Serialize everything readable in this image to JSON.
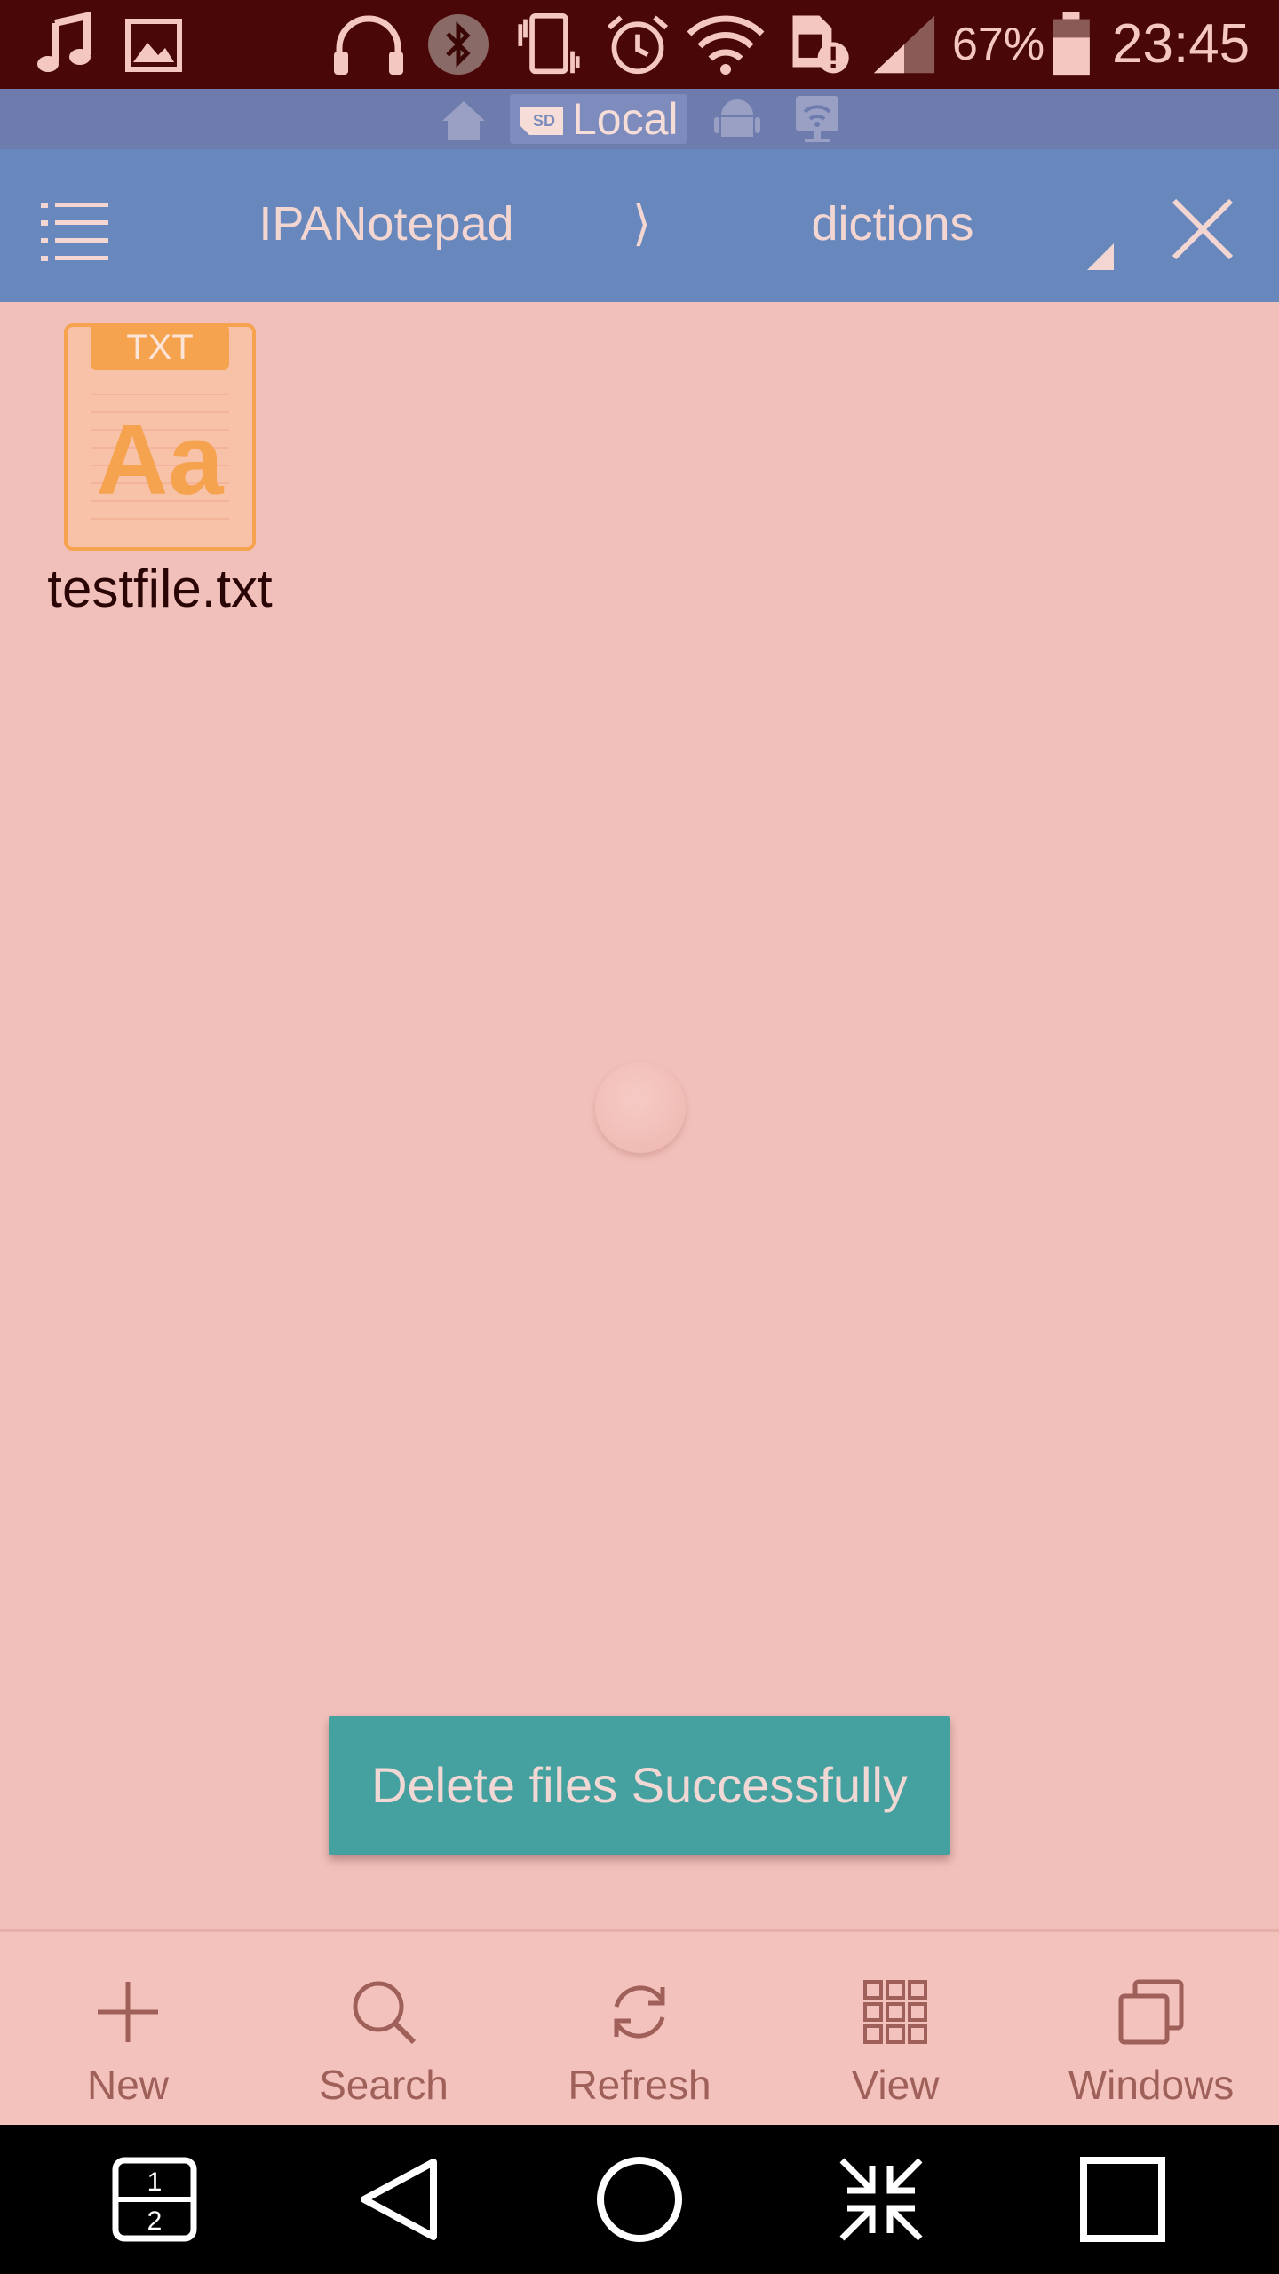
{
  "status_bar": {
    "icons": [
      "music-note-icon",
      "image-icon",
      "headphones-icon",
      "bluetooth-icon",
      "vibrate-icon",
      "alarm-icon",
      "wifi-icon",
      "sim-alert-icon",
      "cell-signal-icon",
      "battery-icon"
    ],
    "battery_percent": "67%",
    "time": "23:45"
  },
  "location_bar": {
    "items": [
      "home-icon",
      "sd-card-icon",
      "android-icon",
      "remote-wifi-icon"
    ],
    "active_label": "Local"
  },
  "toolbar": {
    "breadcrumb": [
      "IPANotepad",
      "dictions"
    ],
    "separator": "⟩",
    "menu_icon": "list-menu-icon",
    "close_icon": "close-icon"
  },
  "files": [
    {
      "name": "testfile.txt",
      "type_badge": "TXT",
      "glyph": "Aa"
    }
  ],
  "toast": {
    "message": "Delete files Successfully"
  },
  "actions": [
    {
      "label": "New",
      "icon": "plus-icon"
    },
    {
      "label": "Search",
      "icon": "search-icon"
    },
    {
      "label": "Refresh",
      "icon": "refresh-icon"
    },
    {
      "label": "View",
      "icon": "grid-view-icon"
    },
    {
      "label": "Windows",
      "icon": "windows-icon"
    }
  ],
  "nav_bar": {
    "buttons": [
      {
        "icon": "dual-window-icon",
        "labels": [
          "1",
          "2"
        ]
      },
      {
        "icon": "back-icon"
      },
      {
        "icon": "home-circle-icon"
      },
      {
        "icon": "collapse-icon"
      },
      {
        "icon": "recents-icon"
      }
    ]
  },
  "colors": {
    "status_bar": "#4a0707",
    "location_bar": "#6e7cad",
    "toolbar": "#6888bd",
    "background": "#f2c0ba",
    "toast": "#45a1a0",
    "file_icon": "#f6a350",
    "action_text": "#a0605a"
  }
}
